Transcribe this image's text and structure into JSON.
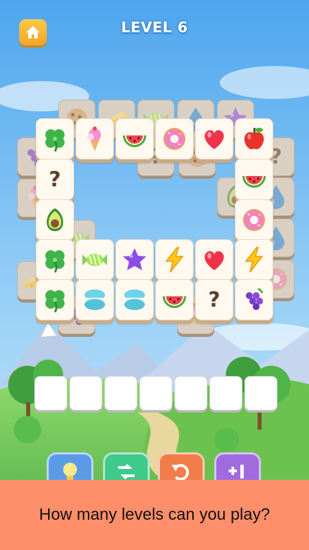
{
  "header": {
    "level_title": "LEVEL 6"
  },
  "board": {
    "under_tiles": [
      {
        "icon": "cookie"
      },
      {
        "icon": "cheese"
      },
      {
        "icon": "candy"
      },
      {
        "icon": "water-drop"
      },
      {
        "icon": "star"
      },
      {
        "icon": "grapes"
      },
      {
        "icon": "question"
      },
      {
        "icon": "question"
      },
      {
        "icon": "cookie"
      },
      {
        "icon": "ice-cream"
      },
      {
        "icon": "avocado"
      },
      {
        "icon": "water-drop"
      },
      {
        "icon": "candy"
      },
      {
        "icon": "water-drop"
      },
      {
        "icon": "cheese"
      },
      {
        "icon": "donut"
      },
      {
        "icon": "grapes"
      },
      {
        "icon": "ice-cream"
      }
    ],
    "rows": [
      {
        "tiles": [
          {
            "icon": "clover"
          },
          {
            "icon": "ice-cream"
          },
          {
            "icon": "watermelon"
          },
          {
            "icon": "donut"
          },
          {
            "icon": "heart"
          },
          {
            "icon": "apple"
          }
        ]
      },
      {
        "tiles": [
          {
            "icon": "question",
            "label": "?"
          },
          {
            "icon": "watermelon"
          }
        ]
      },
      {
        "tiles": [
          {
            "icon": "avocado"
          },
          {
            "icon": "donut"
          }
        ]
      },
      {
        "tiles": [
          {
            "icon": "clover"
          },
          {
            "icon": "candy"
          },
          {
            "icon": "star"
          },
          {
            "icon": "lightning"
          },
          {
            "icon": "heart"
          },
          {
            "icon": "lightning"
          }
        ]
      },
      {
        "tiles": [
          {
            "icon": "clover"
          },
          {
            "icon": "macaron"
          },
          {
            "icon": "macaron"
          },
          {
            "icon": "watermelon"
          },
          {
            "icon": "question",
            "label": "?"
          },
          {
            "icon": "grapes"
          }
        ]
      }
    ]
  },
  "tray": {
    "slots": 7
  },
  "boosters": [
    {
      "name": "hint",
      "icon": "lightbulb-icon",
      "color": "#5a9be8"
    },
    {
      "name": "shuffle",
      "icon": "shuffle-icon",
      "color": "#3fc98a"
    },
    {
      "name": "undo",
      "icon": "undo-icon",
      "color": "#f07d4a"
    },
    {
      "name": "extra-slot",
      "icon": "plus-one-icon",
      "color": "#a16be0"
    }
  ],
  "banner": {
    "text": "How many levels can you play?"
  },
  "colors": {
    "sky": "#6bb7f2",
    "banner": "#ff8f6a",
    "home_button": "#f5a623"
  }
}
